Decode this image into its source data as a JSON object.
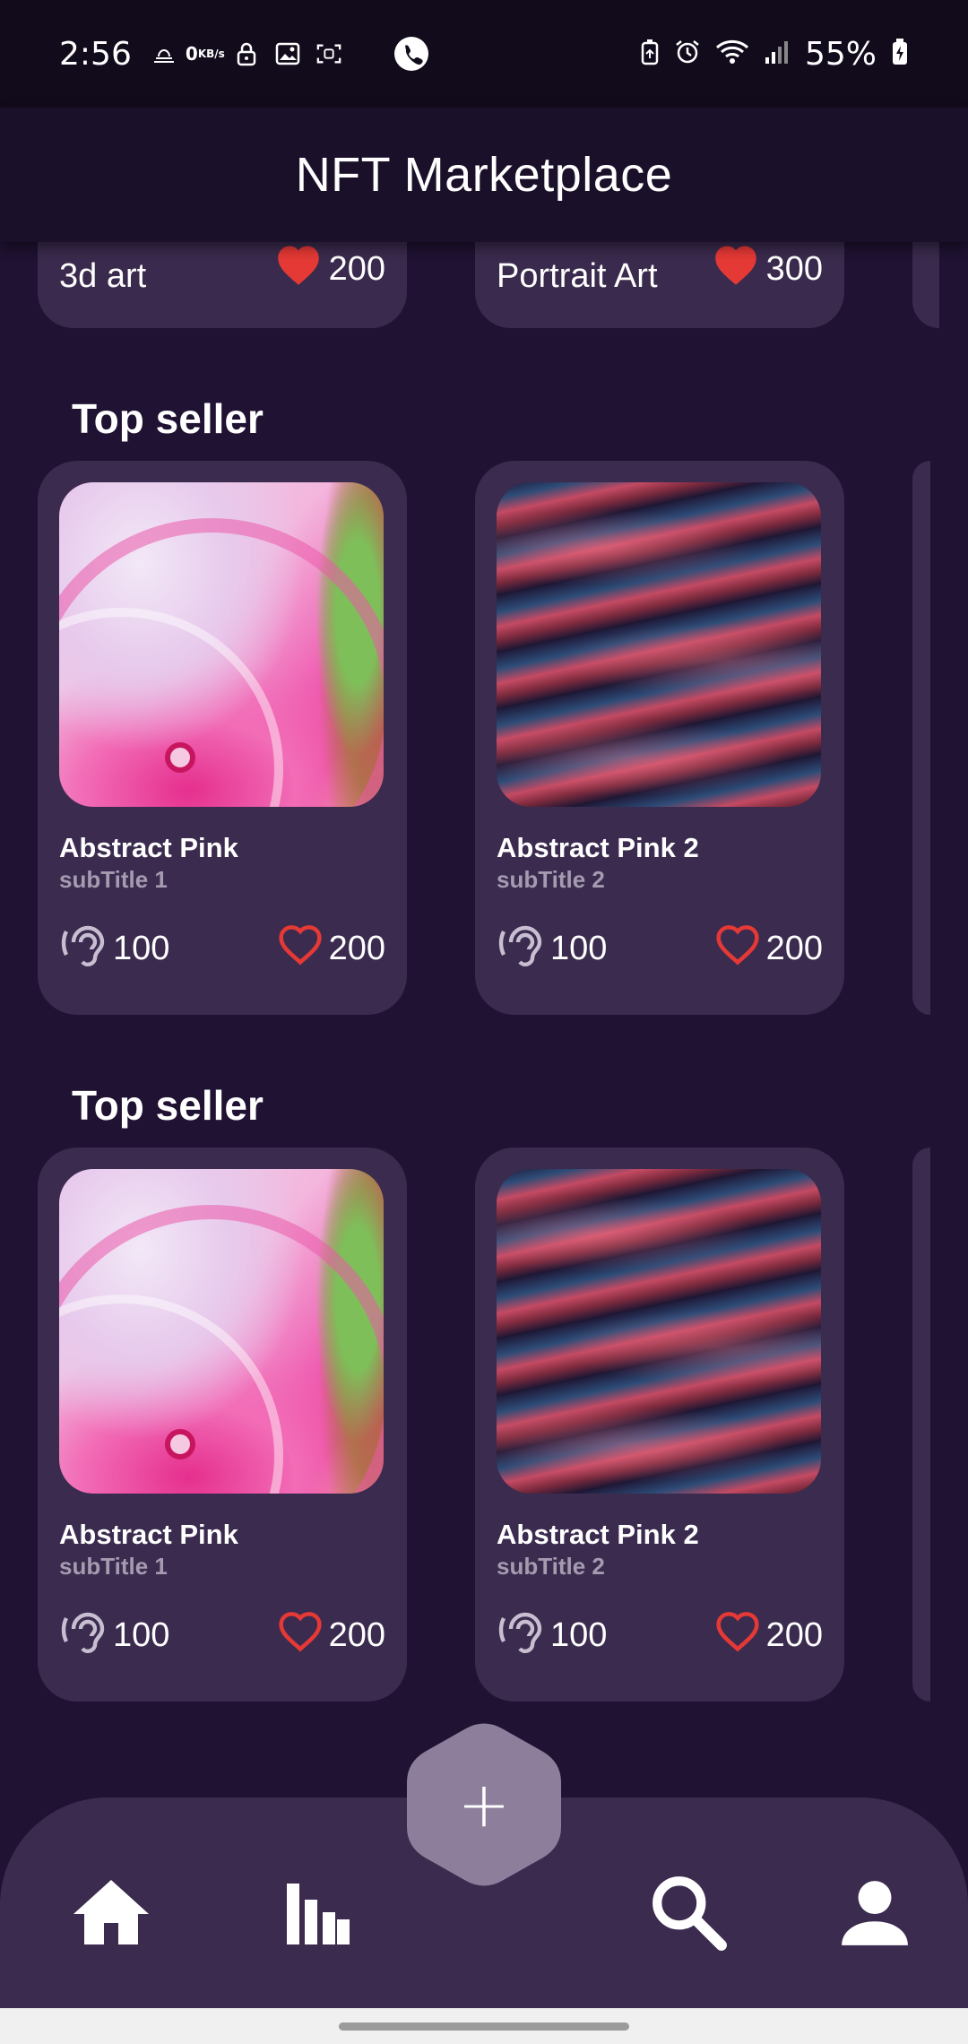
{
  "status_bar": {
    "time": "2:56",
    "network_speed_value": "0",
    "network_speed_unit": "KB/s",
    "battery": "55%"
  },
  "app_bar": {
    "title": "NFT Marketplace"
  },
  "categories": [
    {
      "name": "3d art",
      "likes": "200"
    },
    {
      "name": "Portrait Art",
      "likes": "300"
    }
  ],
  "sections": [
    {
      "title": "Top seller",
      "cards": [
        {
          "title": "Abstract Pink",
          "subtitle": "subTitle 1",
          "listens": "100",
          "likes": "200",
          "image": "abstract-pink"
        },
        {
          "title": "Abstract Pink 2",
          "subtitle": "subTitle 2",
          "listens": "100",
          "likes": "200",
          "image": "abstract-waves"
        }
      ]
    },
    {
      "title": "Top seller",
      "cards": [
        {
          "title": "Abstract Pink",
          "subtitle": "subTitle 1",
          "listens": "100",
          "likes": "200",
          "image": "abstract-pink"
        },
        {
          "title": "Abstract Pink 2",
          "subtitle": "subTitle 2",
          "listens": "100",
          "likes": "200",
          "image": "abstract-waves"
        }
      ]
    }
  ],
  "bottom_nav": {
    "items": [
      "home-icon",
      "stats-icon",
      "add-icon",
      "search-icon",
      "profile-icon"
    ],
    "fab_label": "+"
  },
  "colors": {
    "background": "#1f1232",
    "card": "#3b2b4f",
    "heart": "#e53935",
    "fab": "#8d7f9c"
  }
}
